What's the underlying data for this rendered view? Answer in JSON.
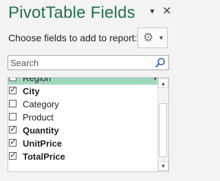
{
  "pane": {
    "title": "PivotTable Fields",
    "title_menu_icon": "dropdown-icon",
    "close_icon": "close-icon",
    "instruction": "Choose fields to add to report:",
    "tools_icon": "gear-icon"
  },
  "search": {
    "placeholder": "Search",
    "value": "",
    "icon": "search-icon"
  },
  "fields": [
    {
      "label": "Region",
      "checked": false,
      "bold": false,
      "selected": true
    },
    {
      "label": "City",
      "checked": true,
      "bold": true,
      "selected": false
    },
    {
      "label": "Category",
      "checked": false,
      "bold": false,
      "selected": false
    },
    {
      "label": "Product",
      "checked": false,
      "bold": false,
      "selected": false
    },
    {
      "label": "Quantity",
      "checked": true,
      "bold": true,
      "selected": false
    },
    {
      "label": "UnitPrice",
      "checked": true,
      "bold": true,
      "selected": false
    },
    {
      "label": "TotalPrice",
      "checked": true,
      "bold": true,
      "selected": false
    }
  ],
  "colors": {
    "title": "#217346",
    "selection": "#a1d8bd"
  }
}
